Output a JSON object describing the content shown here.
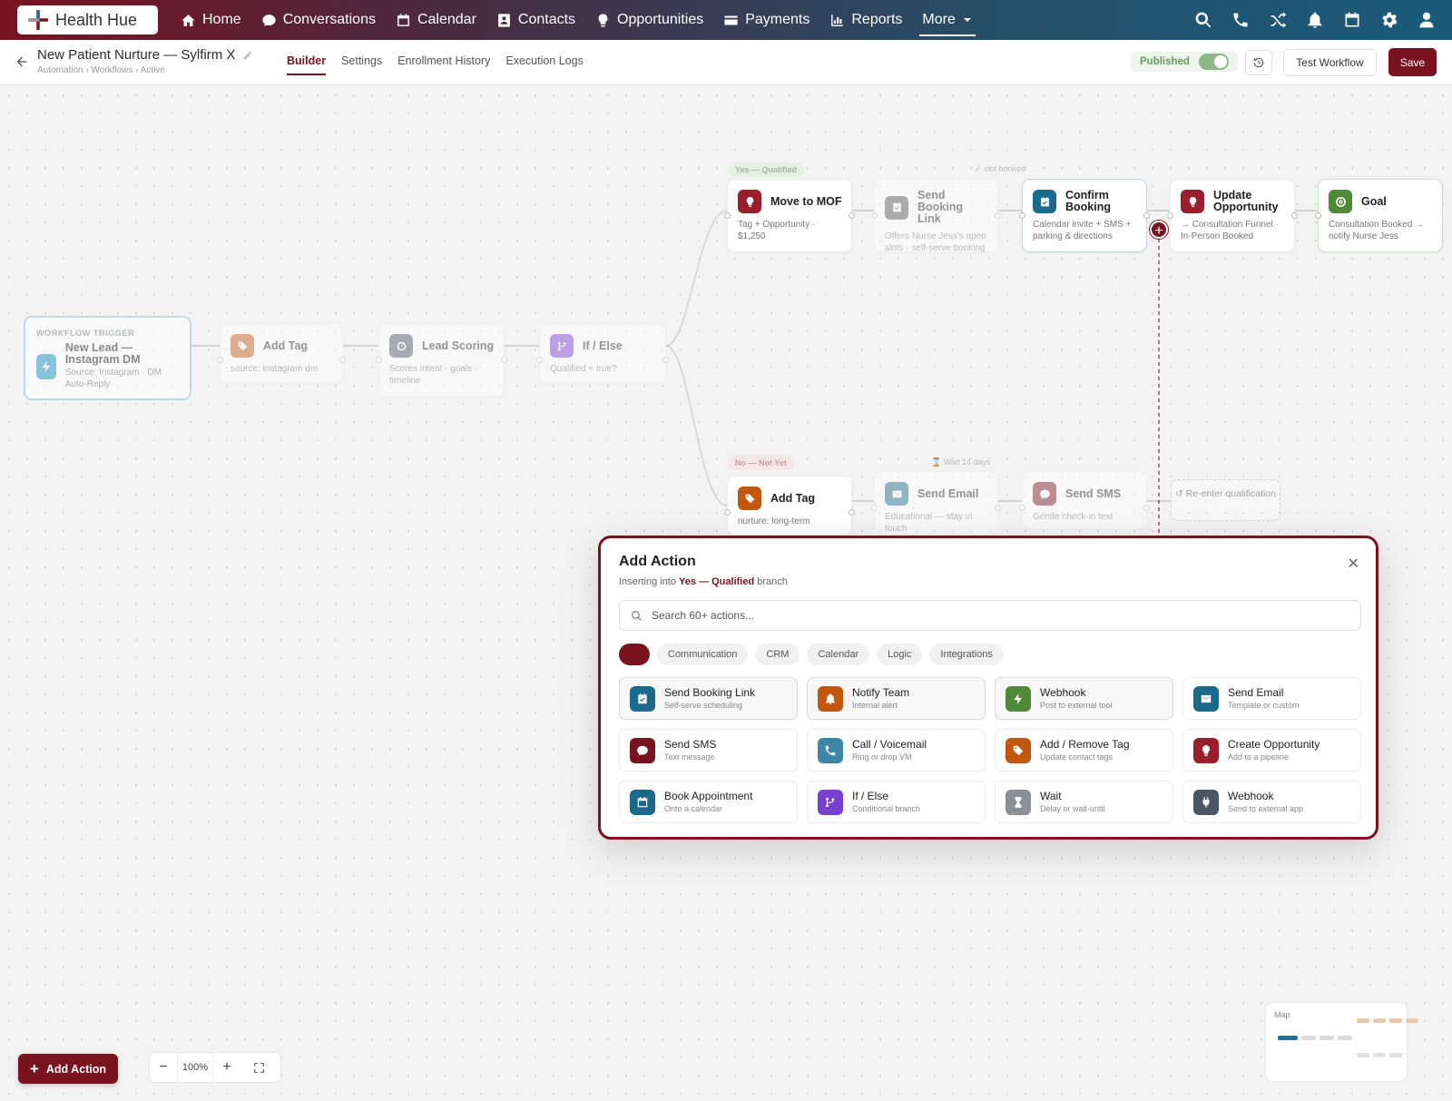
{
  "brand": {
    "name": "Health Hue"
  },
  "nav": {
    "items": [
      {
        "label": "Home",
        "icon": "home-icon"
      },
      {
        "label": "Conversations",
        "icon": "chat-icon"
      },
      {
        "label": "Calendar",
        "icon": "calendar-icon"
      },
      {
        "label": "Contacts",
        "icon": "contacts-icon"
      },
      {
        "label": "Opportunities",
        "icon": "lightbulb-icon"
      },
      {
        "label": "Payments",
        "icon": "card-icon"
      },
      {
        "label": "Reports",
        "icon": "bar-chart-icon"
      },
      {
        "label": "More",
        "icon": "chevron-down-icon"
      }
    ],
    "active": "More",
    "right_icons": [
      "search-icon",
      "phone-icon",
      "shuffle-icon",
      "bell-icon",
      "calendar-icon",
      "gear-icon",
      "user-icon"
    ]
  },
  "header": {
    "title": "New Patient Nurture — Sylfirm X",
    "breadcrumb": "Automation › Workflows › Active",
    "tabs": [
      "Builder",
      "Settings",
      "Enrollment History",
      "Execution Logs"
    ],
    "active_tab": "Builder",
    "published_label": "Published",
    "published": true,
    "test_label": "Test Workflow",
    "save_label": "Save"
  },
  "colors": {
    "brand": "#7a1320",
    "teal": "#1b5b7a"
  },
  "workflow": {
    "trigger": {
      "label": "WORKFLOW TRIGGER",
      "title": "New Lead — Instagram DM",
      "desc": "Source: Instagram · DM Auto-Reply"
    },
    "main": [
      {
        "title": "Add Tag",
        "desc": "source: instagram dm"
      },
      {
        "title": "Lead Scoring",
        "desc": "Scores intent · goals · timeline"
      },
      {
        "title": "If / Else",
        "desc": "Qualified = true?"
      }
    ],
    "yes_branch": {
      "pill": "Yes — Qualified",
      "hint": "✓ slot booked",
      "nodes": [
        {
          "title": "Move to MOF",
          "desc": "Tag + Opportunity · $1,250"
        },
        {
          "title": "Send Booking Link",
          "desc": "Offers Nurse Jess's open slots · self-serve booking"
        },
        {
          "title": "Confirm Booking",
          "desc": "Calendar invite + SMS + parking & directions"
        },
        {
          "title": "Update Opportunity",
          "desc": "→ Consultation Funnel · In-Person Booked"
        },
        {
          "title": "Goal",
          "desc": "Consultation Booked → notify Nurse Jess"
        }
      ]
    },
    "no_branch": {
      "pill": "No — Not Yet",
      "hint": "⌛ Wait 14 days",
      "nodes": [
        {
          "title": "Add Tag",
          "desc": "nurture: long-term"
        },
        {
          "title": "Send Email",
          "desc": "Educational — stay in touch"
        },
        {
          "title": "Send SMS",
          "desc": "Gentle check-in text"
        }
      ],
      "reenter": "↺ Re-enter qualification"
    }
  },
  "modal": {
    "title": "Add Action",
    "sub_prefix": "Inserting into",
    "sub_branch": "Yes — Qualified",
    "sub_suffix": "branch",
    "search_placeholder": "Search 60+ actions...",
    "chips": [
      "",
      "Communication",
      "CRM",
      "Calendar",
      "Logic",
      "Integrations"
    ],
    "actions": [
      {
        "title": "Send Booking Link",
        "desc": "Self-serve scheduling",
        "icon": "calendar-check-icon",
        "color": "#1b6a8c"
      },
      {
        "title": "Notify Team",
        "desc": "Internal alert",
        "icon": "bell-icon",
        "color": "#c2570f"
      },
      {
        "title": "Webhook",
        "desc": "Post to external tool",
        "icon": "bolt-icon",
        "color": "#4f8a3a"
      },
      {
        "title": "Send Email",
        "desc": "Template or custom",
        "icon": "mail-icon",
        "color": "#1b6a8c"
      },
      {
        "title": "Send SMS",
        "desc": "Text message",
        "icon": "chat-icon",
        "color": "#7a1320"
      },
      {
        "title": "Call / Voicemail",
        "desc": "Ring or drop VM",
        "icon": "phone-icon",
        "color": "#3e86a8"
      },
      {
        "title": "Add / Remove Tag",
        "desc": "Update contact tags",
        "icon": "tag-icon",
        "color": "#c2570f"
      },
      {
        "title": "Create Opportunity",
        "desc": "Add to a pipeline",
        "icon": "lightbulb-icon",
        "color": "#9a1f2c"
      },
      {
        "title": "Book Appointment",
        "desc": "Onto a calendar",
        "icon": "calendar-icon",
        "color": "#1b6a8c"
      },
      {
        "title": "If / Else",
        "desc": "Conditional branch",
        "icon": "branch-icon",
        "color": "#7a3ed0"
      },
      {
        "title": "Wait",
        "desc": "Delay or wait-until",
        "icon": "hourglass-icon",
        "color": "#8a8f98"
      },
      {
        "title": "Webhook",
        "desc": "Send to external app",
        "icon": "plug-icon",
        "color": "#4b5563"
      }
    ]
  },
  "footer": {
    "add_action_label": "Add Action",
    "zoom": "100%",
    "minimap_label": "Map"
  }
}
